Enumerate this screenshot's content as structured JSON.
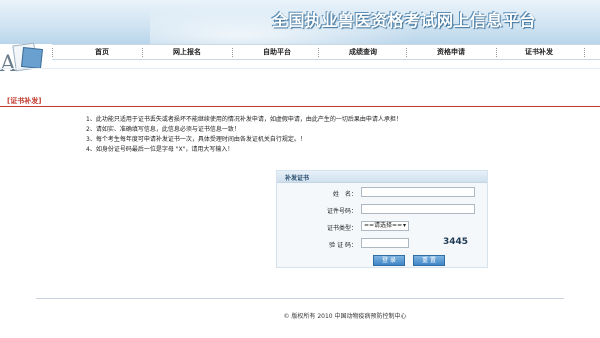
{
  "banner": {
    "title": "全国执业兽医资格考试网上信息平台"
  },
  "nav": {
    "items": [
      {
        "label": "首页"
      },
      {
        "label": "网上报名"
      },
      {
        "label": "自助平台"
      },
      {
        "label": "成绩查询"
      },
      {
        "label": "资格申请"
      },
      {
        "label": "证书补发"
      }
    ]
  },
  "breadcrumb": {
    "label": "[证书补发]"
  },
  "notes": [
    "1、此功能只适用于证书丢失或者损坏不能继续使用的情况补发申请，如虚假申请，由此产生的一切后果由申请人承担！",
    "2、请如实、准确填写信息，此信息必须与证书信息一致！",
    "3、每个考生每年度可申请补发证书一次，具体受理时间由各发证机关自行规定。！",
    "4、如身份证号码最后一位是字母 \"X\"，请用大写输入！"
  ],
  "form": {
    "title": "补发证书",
    "name_label": "姓　名：",
    "name_value": "",
    "cert_no_label": "证件号码：",
    "cert_no_value": "",
    "cert_type_label": "证书类型：",
    "cert_type_selected": "==请选择==",
    "captcha_label": "验 证 码：",
    "captcha_value": "",
    "captcha_code": "3445",
    "login_button": "登 录",
    "reset_button": "重 置"
  },
  "footer": {
    "copyright": "© 版权所有  2010 中国动物疫病预防控制中心"
  },
  "colors": {
    "accent": "#3f86c6",
    "breadcrumb": "#c0392b",
    "banner": "#cfe3f2"
  }
}
